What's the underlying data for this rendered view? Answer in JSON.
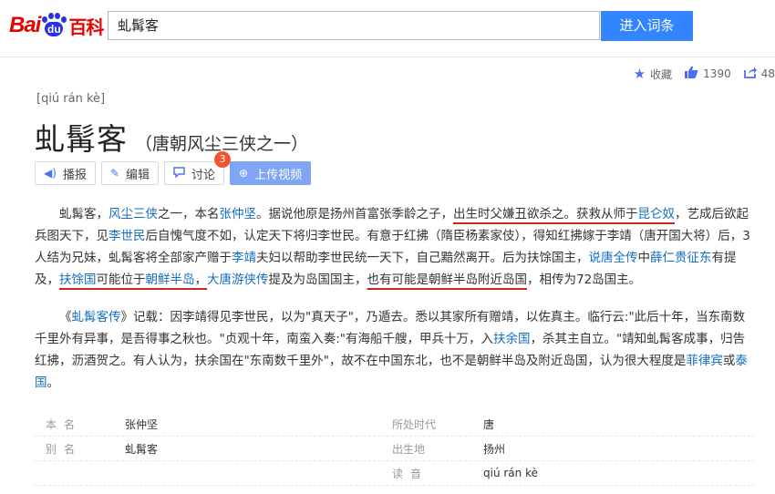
{
  "header": {
    "logo_bai": "Bai",
    "logo_du": "du",
    "logo_baike": "百科",
    "search_value": "虬髯客",
    "search_button": "进入词条"
  },
  "side_actions": {
    "collect": "收藏",
    "likes": "1390",
    "shares": "48"
  },
  "entry": {
    "pinyin": "[qiú rán kè]",
    "title": "虬髯客",
    "subtitle": "（唐朝风尘三侠之一）",
    "actions": {
      "play": "播报",
      "edit": "编辑",
      "discuss": "讨论",
      "discuss_count": "3",
      "upload": "上传视频"
    }
  },
  "paragraph1": [
    {
      "t": "虬髯客，"
    },
    {
      "t": "风尘三侠",
      "link": true
    },
    {
      "t": "之一，本名"
    },
    {
      "t": "张仲坚",
      "link": true
    },
    {
      "t": "。据说他原是扬州首富张季龄之子，"
    },
    {
      "t": "出生时父嫌丑欲杀之。获救从师于",
      "ul": true
    },
    {
      "t": "昆仑奴",
      "link": true,
      "ul": true
    },
    {
      "t": "，艺成后欲起兵图天下，见"
    },
    {
      "t": "李世民",
      "link": true
    },
    {
      "t": "后自愧气度不如，认定天下将归李世民。有意于红拂（隋臣杨素家伎），得知红拂嫁于李靖（唐开国大将）后，3人结为兄妹，虬髯客将全部家产赠于"
    },
    {
      "t": "李靖",
      "link": true
    },
    {
      "t": "夫妇以帮助李世民统一天下，自己黯然离开。后为扶馀国主，"
    },
    {
      "t": "说唐全传",
      "link": true
    },
    {
      "t": "中"
    },
    {
      "t": "薛仁贵征东",
      "link": true
    },
    {
      "t": "有提及，"
    },
    {
      "t": "扶馀国",
      "link": true,
      "ul": true
    },
    {
      "t": "可能位于",
      "ul": true
    },
    {
      "t": "朝鲜半岛",
      "link": true,
      "ul": true
    },
    {
      "t": "，",
      "ul": true
    },
    {
      "t": "大唐游侠传",
      "link": true
    },
    {
      "t": "提及为岛国国主，"
    },
    {
      "t": "也有可能是朝鲜半岛附近岛国",
      "ul": true
    },
    {
      "t": "，相传为72岛国主。"
    }
  ],
  "paragraph2": [
    {
      "t": "《"
    },
    {
      "t": "虬髯客传",
      "link": true
    },
    {
      "t": "》记载：因李靖得见李世民，以为\"真天子\"，乃遁去。悉以其家所有赠靖，以佐真主。临行云:\"此后十年，当东南数千里外有异事，是吾得事之秋也。\"贞观十年，南蛮入奏:\"有海船千艘，甲兵十万，入"
    },
    {
      "t": "扶余国",
      "link": true
    },
    {
      "t": "，杀其主自立。\"靖知虬髯客成事，归告红拂，沥酒贺之。有人认为，扶余国在\"东南数千里外\"，故不在中国东北，也不是朝鲜半岛及附近岛国，认为很大程度是"
    },
    {
      "t": "菲律宾",
      "link": true
    },
    {
      "t": "或"
    },
    {
      "t": "泰国",
      "link": true
    },
    {
      "t": "。"
    }
  ],
  "info": {
    "benming_label": "本名",
    "benming_value": "张仲坚",
    "era_label": "所处时代",
    "era_value": "唐",
    "bieming_label": "别名",
    "bieming_value": "虬髯客",
    "birthplace_label": "出生地",
    "birthplace_value": "扬州",
    "reading_label": "读音",
    "reading_value": "qiú rán kè"
  },
  "colors": {
    "brand_red": "#e10602",
    "brand_blue": "#2932e1",
    "search_button": "#3385ff",
    "link": "#136ec2",
    "underline": "#c12c1f"
  }
}
